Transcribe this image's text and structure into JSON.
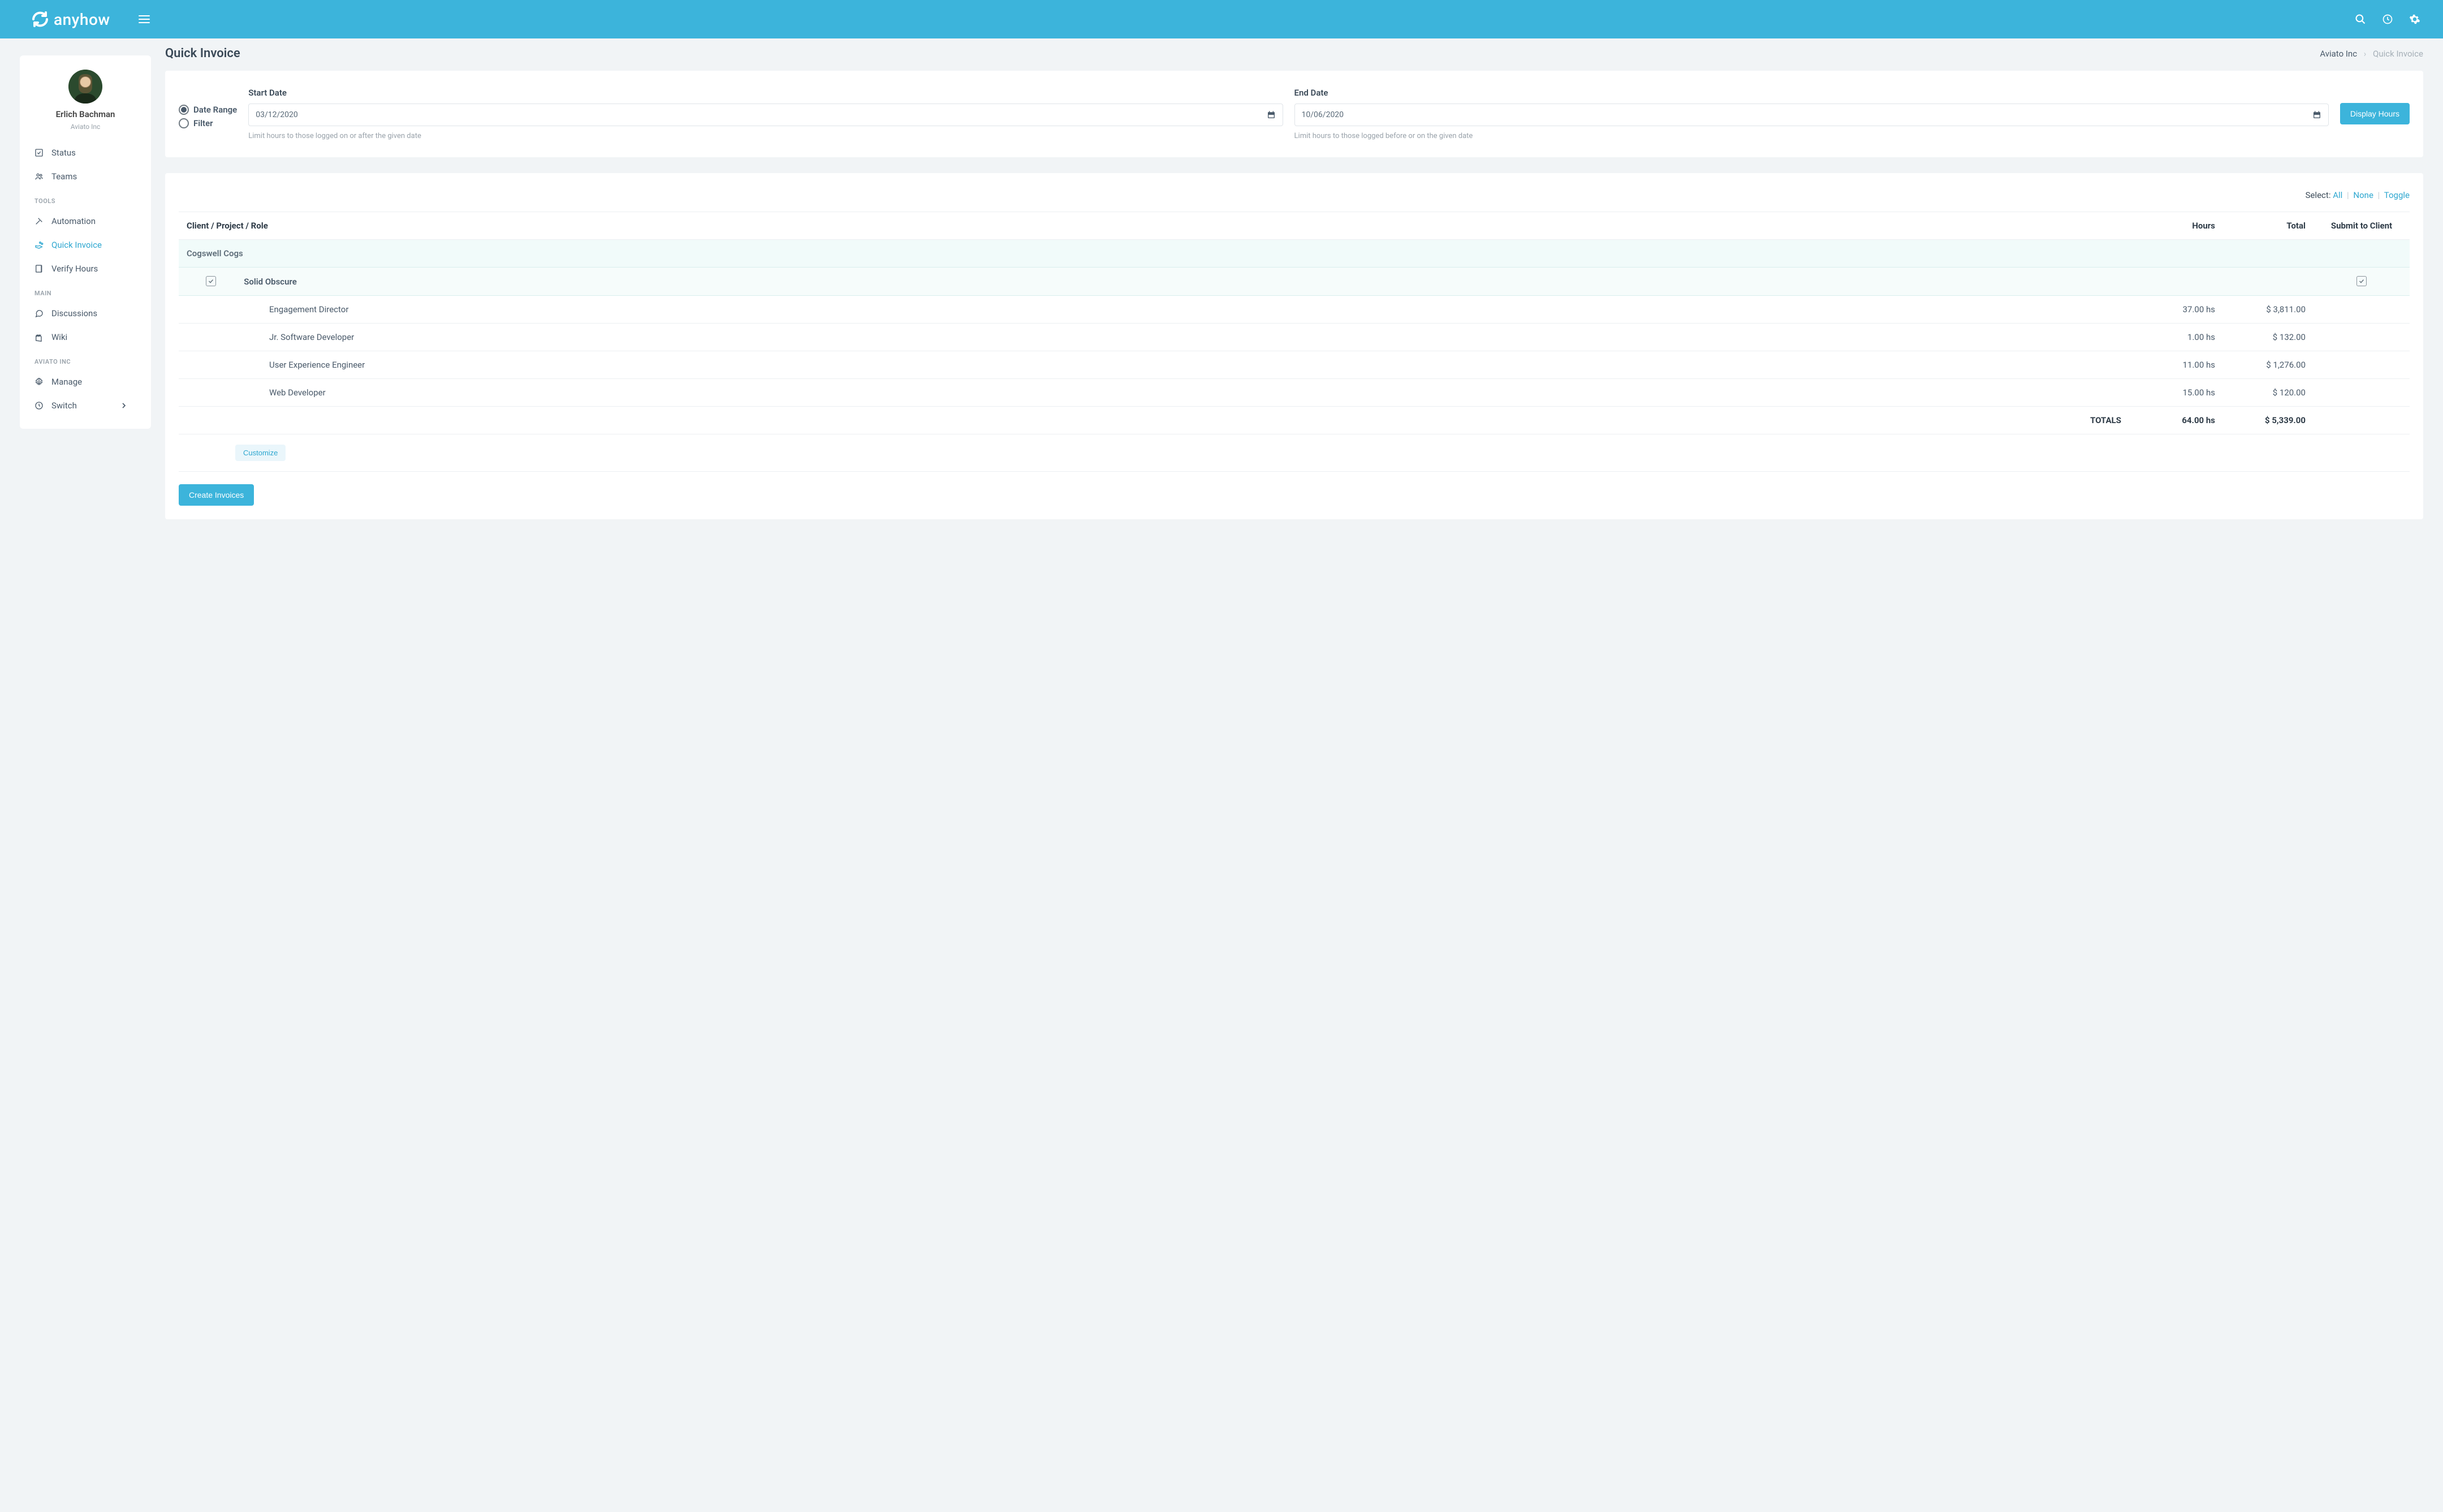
{
  "brand": "anyhow",
  "topbar": {
    "search": "Search",
    "history": "History",
    "settings": "Settings"
  },
  "user": {
    "name": "Erlich Bachman",
    "org": "Aviato Inc"
  },
  "nav": {
    "status": "Status",
    "teams": "Teams",
    "tools_head": "TOOLS",
    "automation": "Automation",
    "quick_invoice": "Quick Invoice",
    "verify_hours": "Verify Hours",
    "main_head": "MAIN",
    "discussions": "Discussions",
    "wiki": "Wiki",
    "org_head": "AVIATO INC",
    "manage": "Manage",
    "switch": "Switch"
  },
  "page": {
    "title": "Quick Invoice"
  },
  "breadcrumb": {
    "org": "Aviato Inc",
    "current": "Quick Invoice"
  },
  "filter": {
    "mode_date_range": "Date Range",
    "mode_filter": "Filter",
    "start_label": "Start Date",
    "start_value": "03/12/2020",
    "start_help": "Limit hours to those logged on or after the given date",
    "end_label": "End Date",
    "end_value": "10/06/2020",
    "end_help": "Limit hours to those logged before or on the given date",
    "display_btn": "Display Hours"
  },
  "select": {
    "label": "Select:",
    "all": "All",
    "none": "None",
    "toggle": "Toggle"
  },
  "table": {
    "head_client": "Client / Project / Role",
    "head_hours": "Hours",
    "head_total": "Total",
    "head_submit": "Submit to Client",
    "client": "Cogswell Cogs",
    "project": "Solid Obscure",
    "rows": [
      {
        "role": "Engagement Director",
        "hours": "37.00 hs",
        "total": "$ 3,811.00"
      },
      {
        "role": "Jr. Software Developer",
        "hours": "1.00 hs",
        "total": "$ 132.00"
      },
      {
        "role": "User Experience Engineer",
        "hours": "11.00 hs",
        "total": "$ 1,276.00"
      },
      {
        "role": "Web Developer",
        "hours": "15.00 hs",
        "total": "$ 120.00"
      }
    ],
    "totals_label": "TOTALS",
    "totals_hours": "64.00 hs",
    "totals_total": "$ 5,339.00",
    "customize": "Customize",
    "create": "Create Invoices"
  }
}
